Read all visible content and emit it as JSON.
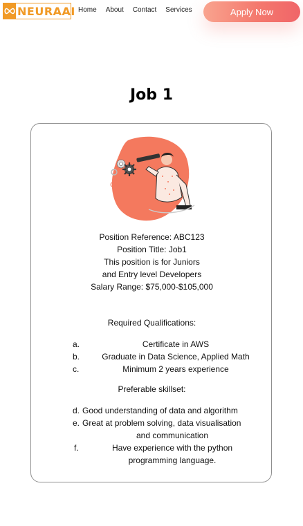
{
  "header": {
    "logo_text": "NEURAAI",
    "logo_icon": "infinity-icon",
    "nav": [
      "Home",
      "About",
      "Contact",
      "Services"
    ],
    "apply_label": "Apply Now"
  },
  "job": {
    "title": "Job 1",
    "illustration": "person-with-telescope-and-gears",
    "info_lines": [
      "Position Reference: ABC123",
      "Position Title: Job1",
      "This position is for Juniors",
      "and Entry level Developers",
      "Salary Range: $75,000-$105,000"
    ],
    "required_title": "Required Qualifications:",
    "required": [
      {
        "marker": "a.",
        "text": "Certificate in AWS"
      },
      {
        "marker": "b.",
        "text": "Graduate in Data Science, Applied Math"
      },
      {
        "marker": "c.",
        "text": "Minimum 2 years experience"
      }
    ],
    "preferable_title": "Preferable skillset:",
    "preferable": [
      {
        "marker": "d.",
        "text": "Good understanding of data and algorithm"
      },
      {
        "marker": "e.",
        "text": "Great at problem solving, data visualisation",
        "text2": "and communication"
      },
      {
        "marker": "f.",
        "text": "Have experience with the python",
        "text2": "programming language."
      }
    ]
  },
  "colors": {
    "brand": "#f19a26",
    "accent": "#f4796e",
    "card_border": "#8f8f8f"
  }
}
